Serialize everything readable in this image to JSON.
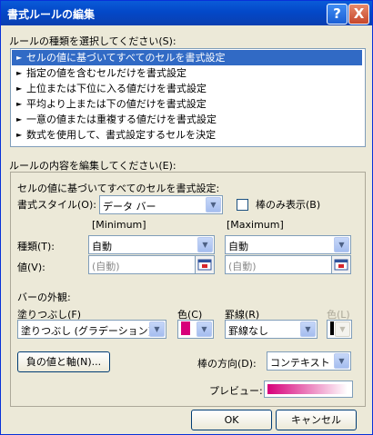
{
  "window": {
    "title": "書式ルールの編集",
    "help_glyph": "?",
    "close_glyph": "X"
  },
  "rule_type": {
    "label": "ルールの種類を選択してください(S):",
    "items": [
      {
        "arrow": "►",
        "label": "セルの値に基づいてすべてのセルを書式設定"
      },
      {
        "arrow": "►",
        "label": "指定の値を含むセルだけを書式設定"
      },
      {
        "arrow": "►",
        "label": "上位または下位に入る値だけを書式設定"
      },
      {
        "arrow": "►",
        "label": "平均より上または下の値だけを書式設定"
      },
      {
        "arrow": "►",
        "label": "一意の値または重複する値だけを書式設定"
      },
      {
        "arrow": "►",
        "label": "数式を使用して、書式設定するセルを決定"
      }
    ],
    "selected_index": 0
  },
  "edit": {
    "label": "ルールの内容を編集してください(E):",
    "heading": "セルの値に基づいてすべてのセルを書式設定:",
    "format_style_label": "書式スタイル(O):",
    "format_style_value": "データ バー",
    "bar_only_label": "棒のみ表示(B)",
    "bar_only_checked": false,
    "min_header": "[Minimum]",
    "max_header": "[Maximum]",
    "type_label": "種類(T):",
    "min_type": "自動",
    "max_type": "自動",
    "value_label": "値(V):",
    "min_value": "(自動)",
    "max_value": "(自動)",
    "appearance_label": "バーの外観:",
    "fill_label": "塗りつぶし(F)",
    "fill_value": "塗りつぶし (グラデーション)",
    "color_label": "色(C)",
    "fill_color": "#d7007a",
    "border_label": "罫線(R)",
    "border_value": "罫線なし",
    "border_color_label": "色(L)",
    "border_color": "#000000",
    "negative_button": "負の値と軸(N)...",
    "direction_label": "棒の方向(D):",
    "direction_value": "コンテキスト",
    "preview_label": "プレビュー:"
  },
  "footer": {
    "ok": "OK",
    "cancel": "キャンセル"
  },
  "icons": {
    "dropdown": "▼",
    "cell_picker": "cell-reference-picker-icon"
  }
}
